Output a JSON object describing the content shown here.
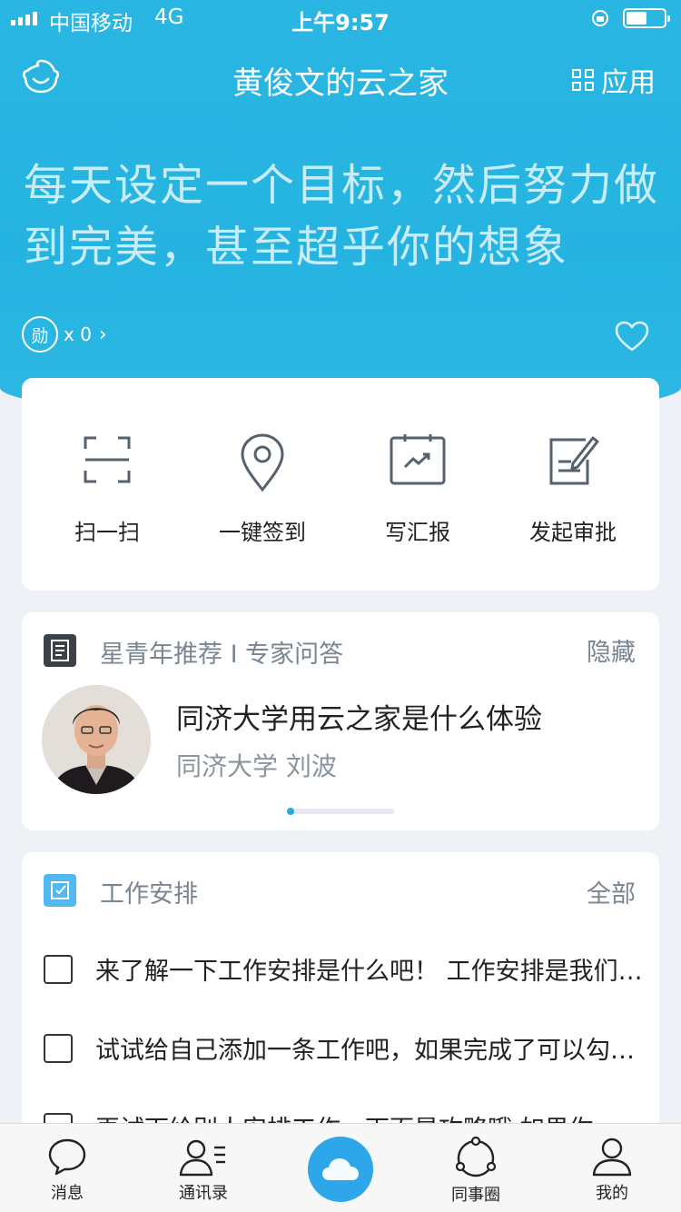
{
  "status_bar": {
    "carrier": "中国移动",
    "network": "4G",
    "time": "上午9:57",
    "battery_level": 0.5
  },
  "header": {
    "title": "黄俊文的云之家",
    "apps_label": "应用",
    "avatar_icon": "baby-face-icon"
  },
  "hero": {
    "motto": "每天设定一个目标，然后努力做到完美，甚至超乎你的想象",
    "medal_char": "勋",
    "medal_count": "x 0"
  },
  "quick_actions": [
    {
      "label": "扫一扫",
      "icon": "scan-icon"
    },
    {
      "label": "一键签到",
      "icon": "location-pin-icon"
    },
    {
      "label": "写汇报",
      "icon": "report-icon"
    },
    {
      "label": "发起审批",
      "icon": "approval-edit-icon"
    }
  ],
  "recommend": {
    "header": "星青年推荐 I 专家问答",
    "hide_label": "隐藏",
    "title": "同济大学用云之家是什么体验",
    "author": "同济大学 刘波"
  },
  "work": {
    "header": "工作安排",
    "all_label": "全部",
    "tasks": [
      "来了解一下工作安排是什么吧！ 工作安排是我们为你准备的",
      "试试给自己添加一条工作吧，如果完成了可以勾选完成",
      "再试下给别人安排工作，下面是攻略哦 如果你"
    ]
  },
  "tab_bar": [
    {
      "label": "消息",
      "icon": "chat-bubble-icon"
    },
    {
      "label": "通讯录",
      "icon": "contacts-icon"
    },
    {
      "label": "",
      "icon": "cloud-icon"
    },
    {
      "label": "同事圈",
      "icon": "circle-network-icon"
    },
    {
      "label": "我的",
      "icon": "user-icon"
    }
  ],
  "colors": {
    "primary": "#25b3e1",
    "tab_center": "#2da6ea",
    "work_icon": "#53b7f0"
  }
}
